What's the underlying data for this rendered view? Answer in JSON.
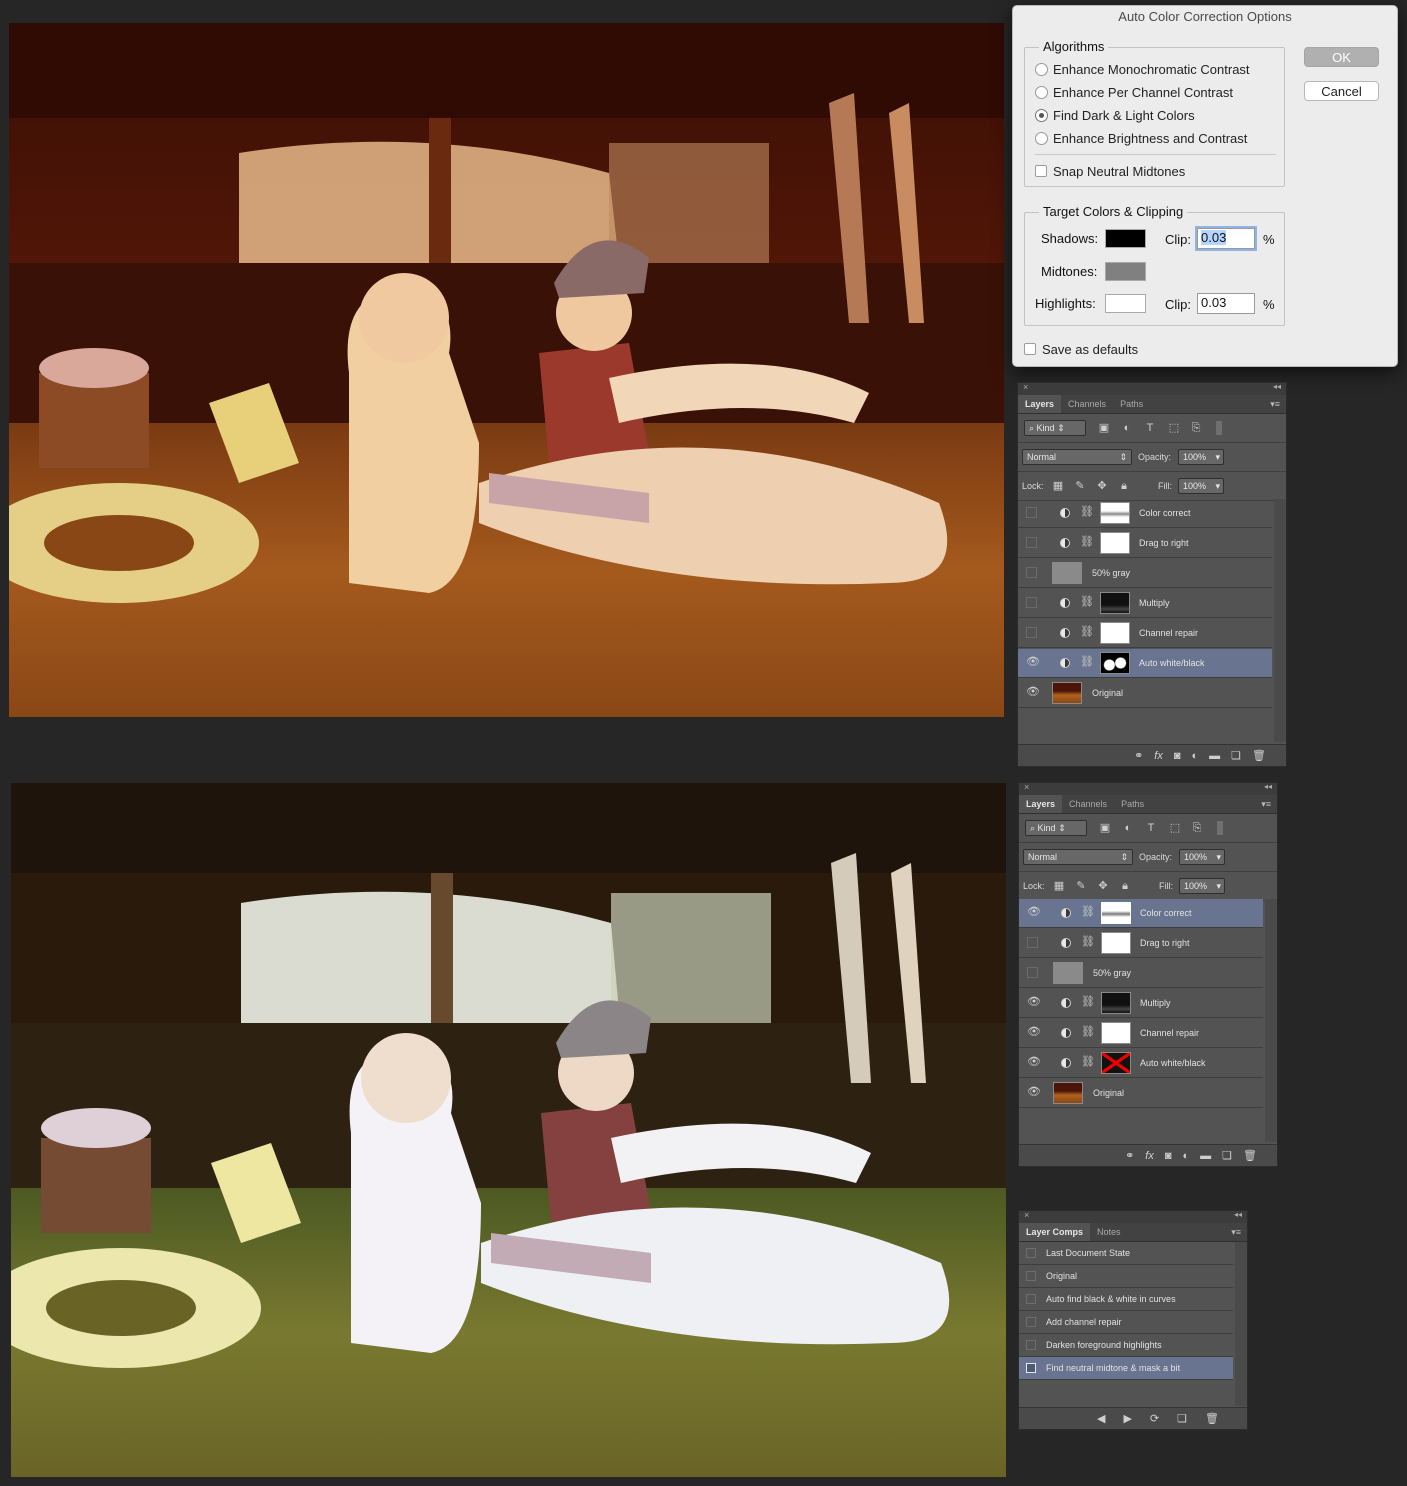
{
  "dialog": {
    "title": "Auto Color Correction Options",
    "algorithms_title": "Algorithms",
    "algorithms": [
      {
        "label": "Enhance Monochromatic Contrast",
        "selected": false
      },
      {
        "label": "Enhance Per Channel Contrast",
        "selected": false
      },
      {
        "label": "Find Dark & Light Colors",
        "selected": true
      },
      {
        "label": "Enhance Brightness and Contrast",
        "selected": false
      }
    ],
    "snap_label": "Snap Neutral Midtones",
    "snap_checked": false,
    "target_title": "Target Colors & Clipping",
    "shadows_label": "Shadows:",
    "midtones_label": "Midtones:",
    "highlights_label": "Highlights:",
    "clip_label": "Clip:",
    "percent": "%",
    "shadows_clip": "0.03",
    "highlights_clip": "0.03",
    "shadows_color": "#000000",
    "midtones_color": "#808080",
    "highlights_color": "#ffffff",
    "save_defaults_label": "Save as defaults",
    "ok_label": "OK",
    "cancel_label": "Cancel"
  },
  "layers_top": {
    "tabs": [
      "Layers",
      "Channels",
      "Paths"
    ],
    "kind_label": "Kind",
    "blend_mode": "Normal",
    "opacity_label": "Opacity:",
    "opacity": "100%",
    "lock_label": "Lock:",
    "fill_label": "Fill:",
    "fill": "100%",
    "layers": [
      {
        "name": "Color correct",
        "visible": false,
        "selected": false
      },
      {
        "name": "Drag to right",
        "visible": false,
        "selected": false
      },
      {
        "name": "50% gray",
        "visible": false,
        "selected": false
      },
      {
        "name": "Multiply",
        "visible": false,
        "selected": false
      },
      {
        "name": "Channel repair",
        "visible": false,
        "selected": false
      },
      {
        "name": "Auto white/black",
        "visible": true,
        "selected": true
      },
      {
        "name": "Original",
        "visible": true,
        "selected": false
      }
    ]
  },
  "layers_bottom": {
    "tabs": [
      "Layers",
      "Channels",
      "Paths"
    ],
    "kind_label": "Kind",
    "blend_mode": "Normal",
    "opacity_label": "Opacity:",
    "opacity": "100%",
    "lock_label": "Lock:",
    "fill_label": "Fill:",
    "fill": "100%",
    "layers": [
      {
        "name": "Color correct",
        "visible": true,
        "selected": true
      },
      {
        "name": "Drag to right",
        "visible": false,
        "selected": false
      },
      {
        "name": "50% gray",
        "visible": false,
        "selected": false
      },
      {
        "name": "Multiply",
        "visible": true,
        "selected": false
      },
      {
        "name": "Channel repair",
        "visible": true,
        "selected": false
      },
      {
        "name": "Auto white/black",
        "visible": true,
        "selected": false
      },
      {
        "name": "Original",
        "visible": true,
        "selected": false
      }
    ]
  },
  "layer_comps": {
    "tabs": [
      "Layer Comps",
      "Notes"
    ],
    "items": [
      {
        "name": "Last Document State",
        "selected": false
      },
      {
        "name": "Original",
        "selected": false
      },
      {
        "name": "Auto find black & white in curves",
        "selected": false
      },
      {
        "name": "Add channel repair",
        "selected": false
      },
      {
        "name": "Darken foreground highlights",
        "selected": false
      },
      {
        "name": "Find neutral midtone & mask a bit",
        "selected": true
      }
    ]
  },
  "colors": {
    "app_bg": "#262626",
    "panel_bg": "#535353",
    "selection": "#697590",
    "dialog_bg": "#ececec"
  }
}
